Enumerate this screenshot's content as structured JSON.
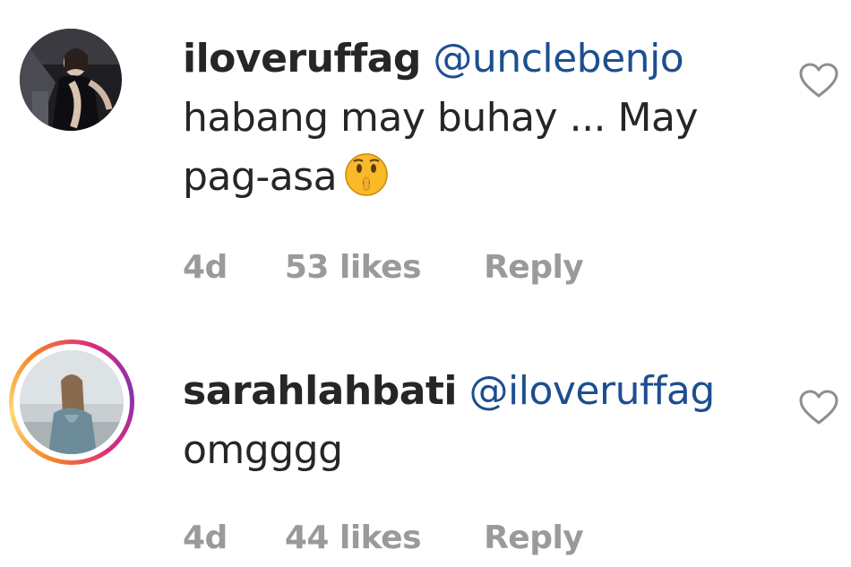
{
  "comments": [
    {
      "username": "iloveruffag",
      "mention": "@unclebenjo",
      "text": "habang may buhay ... May pag-asa",
      "emoji_icon": "hushed-face-emoji",
      "time": "4d",
      "likes": "53 likes",
      "reply_label": "Reply",
      "story_ring": false
    },
    {
      "username": "sarahlahbati",
      "mention": "@iloveruffag",
      "text": "omgggg",
      "time": "4d",
      "likes": "44 likes",
      "reply_label": "Reply",
      "story_ring": true
    }
  ],
  "colors": {
    "mention": "#1d4f8f",
    "meta": "#9a9a9a",
    "text": "#262626"
  }
}
